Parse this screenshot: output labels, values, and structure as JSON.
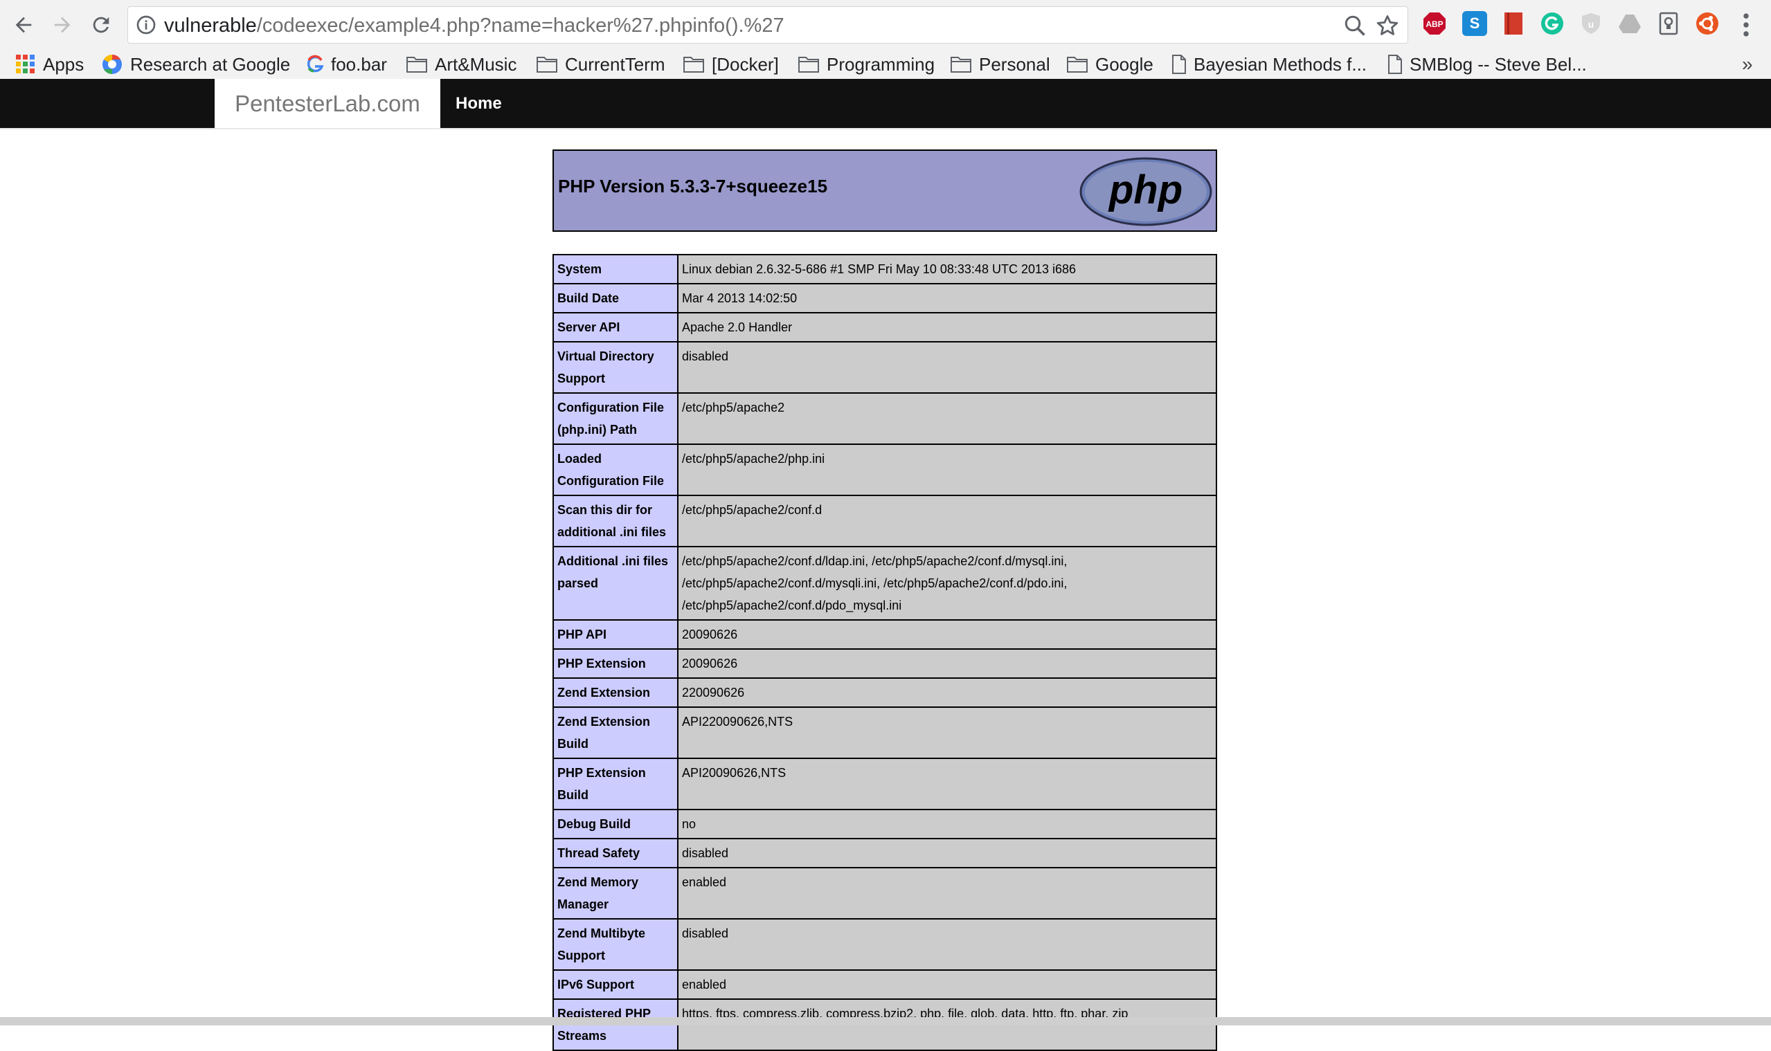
{
  "browser": {
    "url_host": "vulnerable",
    "url_path": "/codeexec/example4.php?name=hacker%27.phpinfo().%27",
    "extensions": [
      "adblock-icon",
      "skype-icon",
      "bookmark-manager-icon",
      "grammarly-icon",
      "ublock-icon",
      "drive-icon",
      "keep-icon",
      "ubuntu-icon"
    ],
    "extension_labels": {
      "adblock": "ABP",
      "skype": "S"
    },
    "bookmarks": [
      {
        "label": "Apps",
        "icon": "apps-grid-icon"
      },
      {
        "label": "Research at Google",
        "icon": "google-color-icon"
      },
      {
        "label": "foo.bar",
        "icon": "google-g-icon"
      },
      {
        "label": "Art&Music",
        "icon": "folder-icon"
      },
      {
        "label": "CurrentTerm",
        "icon": "folder-icon"
      },
      {
        "label": "[Docker]",
        "icon": "folder-icon"
      },
      {
        "label": "Programming",
        "icon": "folder-icon"
      },
      {
        "label": "Personal",
        "icon": "folder-icon"
      },
      {
        "label": "Google",
        "icon": "folder-icon"
      },
      {
        "label": "Bayesian Methods f...",
        "icon": "page-icon"
      },
      {
        "label": "SMBlog -- Steve Bel...",
        "icon": "page-icon"
      }
    ],
    "more_bookmarks": "»"
  },
  "site": {
    "brand": "PentesterLab.com",
    "nav_home": "Home"
  },
  "phpinfo": {
    "version": "PHP Version 5.3.3-7+squeeze15",
    "logo_text": "php",
    "rows": [
      {
        "label": "System",
        "value": "Linux debian 2.6.32-5-686 #1 SMP Fri May 10 08:33:48 UTC 2013 i686"
      },
      {
        "label": "Build Date",
        "value": "Mar 4 2013 14:02:50"
      },
      {
        "label": "Server API",
        "value": "Apache 2.0 Handler"
      },
      {
        "label": "Virtual Directory Support",
        "value": "disabled"
      },
      {
        "label": "Configuration File (php.ini) Path",
        "value": "/etc/php5/apache2"
      },
      {
        "label": "Loaded Configuration File",
        "value": "/etc/php5/apache2/php.ini"
      },
      {
        "label": "Scan this dir for additional .ini files",
        "value": "/etc/php5/apache2/conf.d"
      },
      {
        "label": "Additional .ini files parsed",
        "value": "/etc/php5/apache2/conf.d/ldap.ini, /etc/php5/apache2/conf.d/mysql.ini, /etc/php5/apache2/conf.d/mysqli.ini, /etc/php5/apache2/conf.d/pdo.ini, /etc/php5/apache2/conf.d/pdo_mysql.ini"
      },
      {
        "label": "PHP API",
        "value": "20090626"
      },
      {
        "label": "PHP Extension",
        "value": "20090626"
      },
      {
        "label": "Zend Extension",
        "value": "220090626"
      },
      {
        "label": "Zend Extension Build",
        "value": "API220090626,NTS"
      },
      {
        "label": "PHP Extension Build",
        "value": "API20090626,NTS"
      },
      {
        "label": "Debug Build",
        "value": "no"
      },
      {
        "label": "Thread Safety",
        "value": "disabled"
      },
      {
        "label": "Zend Memory Manager",
        "value": "enabled"
      },
      {
        "label": "Zend Multibyte Support",
        "value": "disabled"
      },
      {
        "label": "IPv6 Support",
        "value": "enabled"
      },
      {
        "label": "Registered PHP Streams",
        "value": "https, ftps, compress.zlib, compress.bzip2, php, file, glob, data, http, ftp, phar, zip"
      }
    ]
  },
  "colors": {
    "php_header": "#9999cc",
    "label_cell": "#ccccff",
    "value_cell": "#cccccc",
    "navbar": "#111111"
  }
}
